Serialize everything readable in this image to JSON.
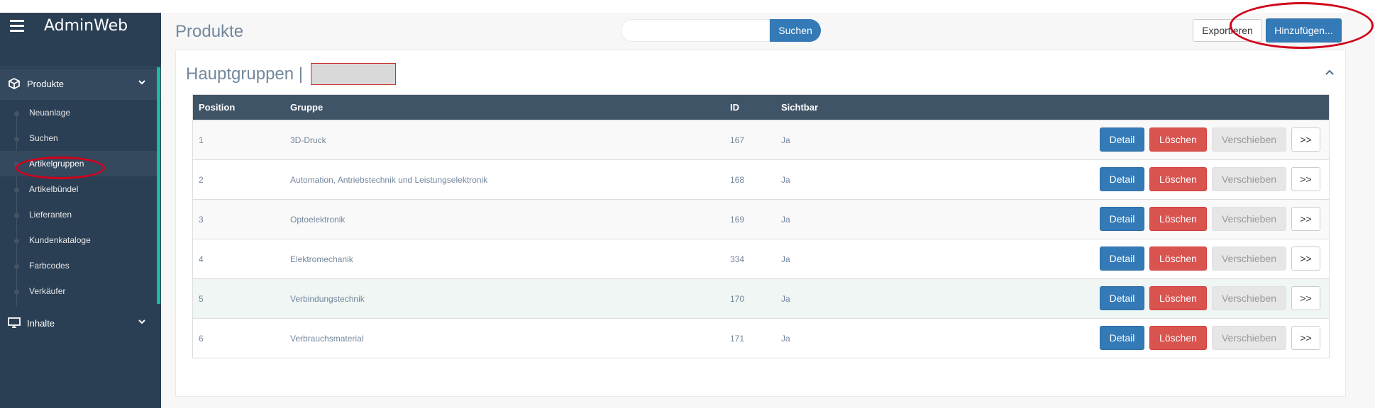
{
  "app": {
    "title": "AdminWeb"
  },
  "sidebar": {
    "sections": [
      {
        "label": "Produkte",
        "icon": "cube-icon"
      },
      {
        "label": "Inhalte",
        "icon": "monitor-icon"
      }
    ],
    "items": [
      {
        "label": "Neuanlage"
      },
      {
        "label": "Suchen"
      },
      {
        "label": "Artikelgruppen"
      },
      {
        "label": "Artikelbündel"
      },
      {
        "label": "Lieferanten"
      },
      {
        "label": "Kundenkataloge"
      },
      {
        "label": "Farbcodes"
      },
      {
        "label": "Verkäufer"
      }
    ],
    "active_item": "Artikelgruppen"
  },
  "header": {
    "page_title": "Produkte",
    "search": {
      "value": "",
      "placeholder": "",
      "button_label": "Suchen"
    },
    "export_label": "Exportieren",
    "add_label": "Hinzufügen..."
  },
  "panel": {
    "title": "Hauptgruppen |",
    "table": {
      "columns": [
        "Position",
        "Gruppe",
        "ID",
        "Sichtbar"
      ],
      "rows": [
        {
          "position": "1",
          "gruppe": "3D-Druck",
          "id": "167",
          "sichtbar": "Ja"
        },
        {
          "position": "2",
          "gruppe": "Automation, Antriebstechnik und Leistungselektronik",
          "id": "168",
          "sichtbar": "Ja"
        },
        {
          "position": "3",
          "gruppe": "Optoelektronik",
          "id": "169",
          "sichtbar": "Ja"
        },
        {
          "position": "4",
          "gruppe": "Elektromechanik",
          "id": "334",
          "sichtbar": "Ja"
        },
        {
          "position": "5",
          "gruppe": "Verbindungstechnik",
          "id": "170",
          "sichtbar": "Ja"
        },
        {
          "position": "6",
          "gruppe": "Verbrauchsmaterial",
          "id": "171",
          "sichtbar": "Ja"
        }
      ],
      "actions": {
        "detail": "Detail",
        "delete": "Löschen",
        "move": "Verschieben",
        "next": ">>"
      }
    }
  },
  "colors": {
    "sidebar_bg": "#2a3f54",
    "accent_green": "#1abb9c",
    "primary": "#337ab7",
    "danger": "#d9534f",
    "annotation_red": "#d0021b"
  }
}
